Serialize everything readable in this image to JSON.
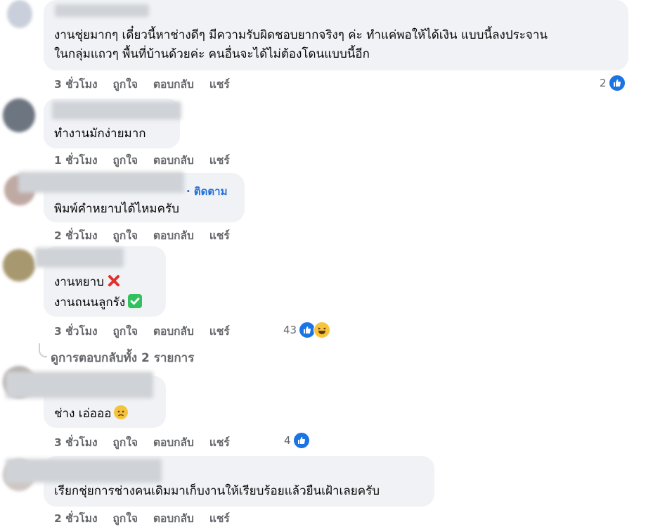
{
  "comments": [
    {
      "text": [
        "งานชุ่ยมากๆ เดี๋ยวนี้หาช่างดีๆ มีความรับผิดชอบยากจริงๆ ค่ะ ทำแค่พอให้ได้เงิน แบบนี้ลงประจาน",
        "ในกลุ่มแถวๆ พื้นที่บ้านด้วยค่ะ คนอื่นจะได้ไม่ต้องโดนแบบนี้อีก"
      ],
      "time": "3 ชั่วโมง",
      "like": "ถูกใจ",
      "reply": "ตอบกลับ",
      "share": "แชร์",
      "reaction_count": "2"
    },
    {
      "text": [
        "ทำงานมักง่ายมาก"
      ],
      "time": "1 ชั่วโมง",
      "like": "ถูกใจ",
      "reply": "ตอบกลับ",
      "share": "แชร์"
    },
    {
      "follow": "· ติดตาม",
      "text": [
        "พิมพ์คำหยาบได้ไหมครับ"
      ],
      "time": "2 ชั่วโมง",
      "like": "ถูกใจ",
      "reply": "ตอบกลับ",
      "share": "แชร์"
    },
    {
      "text": [
        "งานหยาบ",
        "งานถนนลูกรัง"
      ],
      "time": "3 ชั่วโมง",
      "like": "ถูกใจ",
      "reply": "ตอบกลับ",
      "share": "แชร์",
      "reaction_count": "43"
    },
    {
      "text": [
        "ช่าง เอ่อออ"
      ],
      "time": "3 ชั่วโมง",
      "like": "ถูกใจ",
      "reply": "ตอบกลับ",
      "share": "แชร์",
      "reaction_count": "4"
    },
    {
      "text": [
        "เรียกชุ่ยการช่างคนเดิมมาเก็บงานให้เรียบร้อยแล้วยืนเฝ้าเลยครับ"
      ],
      "time": "2 ชั่วโมง",
      "like": "ถูกใจ",
      "reply": "ตอบกลับ",
      "share": "แชร์"
    }
  ],
  "view_replies": "ดูการตอบกลับทั้ง 2 รายการ",
  "icons": {
    "like": "like-reaction-icon",
    "haha": "haha-reaction-icon",
    "cross": "cross-mark-emoji",
    "check": "check-mark-emoji",
    "sad": "sad-face-emoji"
  },
  "colors": {
    "bubble": "#f0f2f5",
    "meta": "#65676b",
    "link": "#216fdb",
    "like_blue": "#1b74e4"
  }
}
